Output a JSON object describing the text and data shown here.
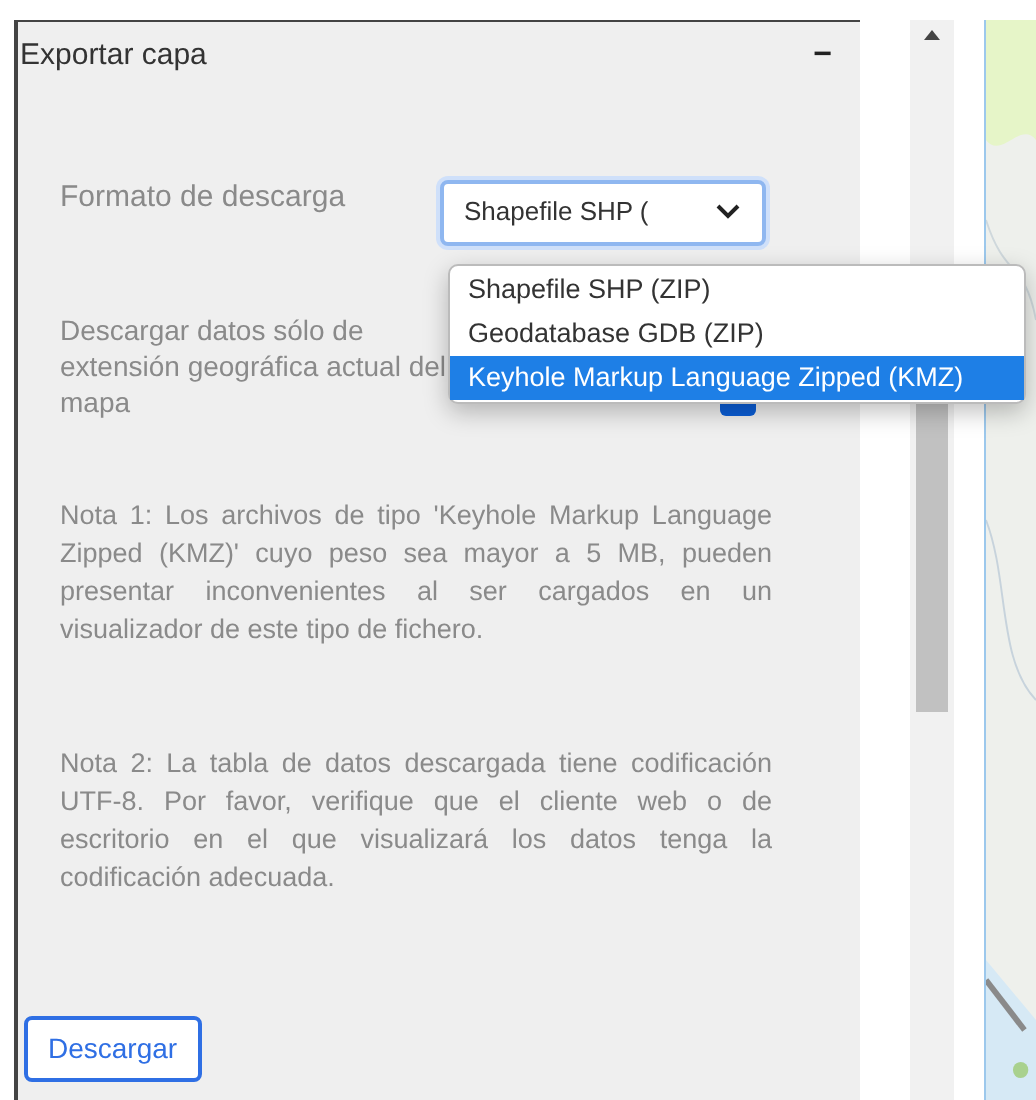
{
  "panel": {
    "title": "Exportar capa",
    "collapse_icon": "−"
  },
  "format": {
    "label": "Formato de descarga",
    "value": "Shapefile SHP (",
    "expanded": true,
    "options": [
      {
        "label": "Shapefile SHP (ZIP)",
        "selected": false
      },
      {
        "label": "Geodatabase GDB (ZIP)",
        "selected": false
      },
      {
        "label": "Keyhole Markup Language Zipped (KMZ)",
        "selected": true
      }
    ]
  },
  "extent": {
    "label_lines": [
      "Descargar datos sólo de",
      "extensión geográfica actual del",
      "mapa"
    ],
    "checked": true
  },
  "notes": [
    "Nota 1: Los archivos de tipo 'Keyhole Markup Language Zipped (KMZ)' cuyo peso sea mayor a 5 MB, pueden presentar inconvenientes al ser cargados en un visualizador de este tipo de fichero.",
    "Nota 2: La tabla de datos descargada tiene codificación UTF-8. Por favor, verifique que el cliente web o de escritorio en el que visualizará los datos tenga la codificación adecuada."
  ],
  "download_button": "Descargar"
}
